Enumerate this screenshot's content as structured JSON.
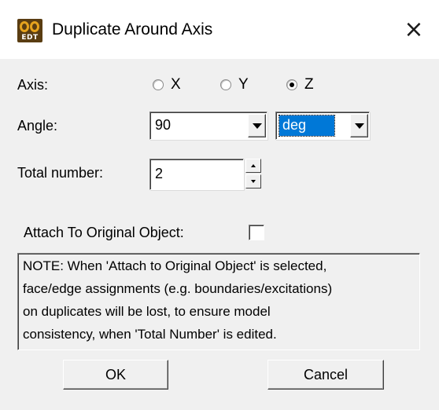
{
  "window": {
    "title": "Duplicate Around Axis",
    "icon_label": "EDT",
    "close_glyph": "×"
  },
  "axis": {
    "label": "Axis:",
    "options": [
      {
        "label": "X",
        "selected": false
      },
      {
        "label": "Y",
        "selected": false
      },
      {
        "label": "Z",
        "selected": true
      }
    ]
  },
  "angle": {
    "label": "Angle:",
    "value": "90",
    "unit": "deg"
  },
  "total_number": {
    "label": "Total number:",
    "value": "2"
  },
  "attach": {
    "label": "Attach To Original Object:",
    "checked": false
  },
  "note": {
    "lines": [
      "NOTE:  When 'Attach to Original Object' is selected,",
      "face/edge assignments (e.g. boundaries/excitations)",
      "on duplicates will be lost, to ensure model",
      "consistency, when 'Total Number' is edited."
    ]
  },
  "buttons": {
    "ok": "OK",
    "cancel": "Cancel"
  },
  "colors": {
    "dialog_bg": "#f0f0f0",
    "selection_blue": "#0078d7",
    "icon_brown": "#5a3d12",
    "icon_gold": "#e6a31e"
  },
  "icons": [
    "app-logo-icon",
    "close-icon",
    "dropdown-arrow-icon",
    "spin-up-icon",
    "spin-down-icon"
  ]
}
